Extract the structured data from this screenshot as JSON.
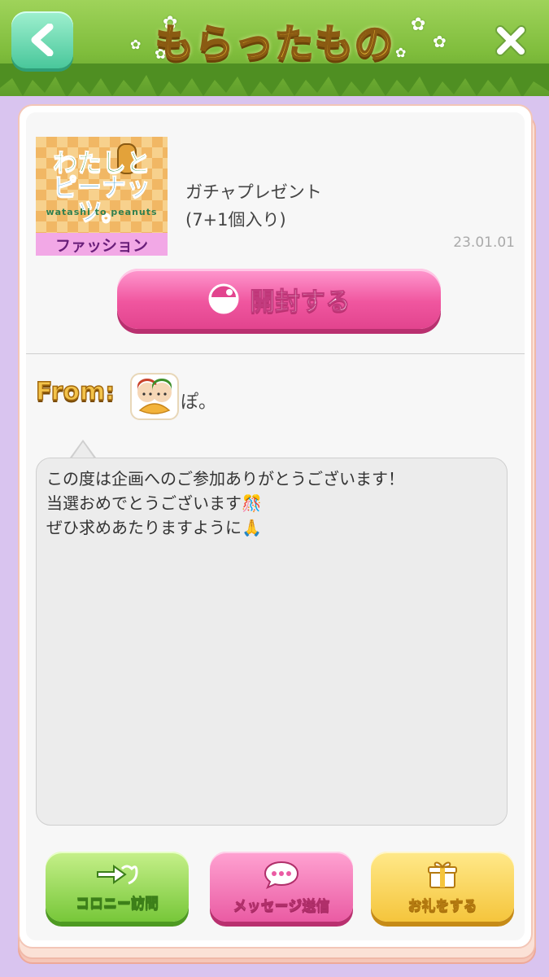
{
  "header": {
    "title": "もらったもの"
  },
  "item": {
    "thumbnail_logo_line1": "わたしと",
    "thumbnail_logo_line2": "ピーナッツ。",
    "thumbnail_subtitle": "watashi to peanuts",
    "category": "ファッション",
    "name": "ガチャプレゼント",
    "count": "(7+1個入り)",
    "date": "23.01.01"
  },
  "open_button": {
    "label": "開封する"
  },
  "from": {
    "label": "From:",
    "sender_name": "ぽ。"
  },
  "message": {
    "lines": [
      "この度は企画へのご参加ありがとうございます！",
      "当選おめでとうございます🎊",
      "ぜひ求めあたりますように🙏"
    ]
  },
  "actions": {
    "colony_visit": "コロニー訪問",
    "send_message": "メッセージ送信",
    "thank": "お礼をする"
  },
  "colors": {
    "header_green": "#7fbd3c",
    "title_gold": "#f6c93a",
    "open_pink": "#f0569f",
    "background_lavender": "#d9c4ef"
  }
}
